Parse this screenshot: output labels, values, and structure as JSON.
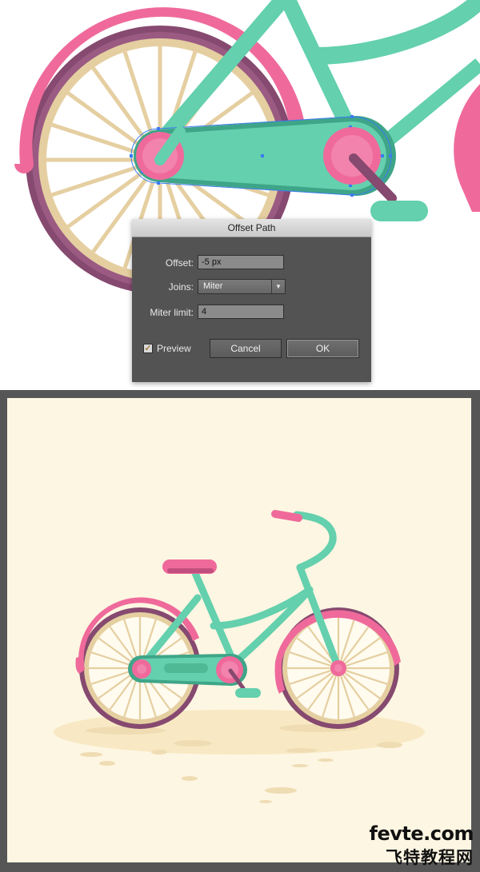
{
  "dialog": {
    "title": "Offset Path",
    "offset_label": "Offset:",
    "offset_value": "-5 px",
    "joins_label": "Joins:",
    "joins_value": "Miter",
    "miter_limit_label": "Miter limit:",
    "miter_limit_value": "4",
    "preview_label": "Preview",
    "preview_checked": true,
    "cancel_label": "Cancel",
    "ok_label": "OK"
  },
  "watermark": {
    "line1": "fevte.com",
    "line2": "飞特教程网"
  },
  "colors": {
    "mint": "#64d0ad",
    "mint_dark": "#3fa588",
    "pink": "#ef6a9b",
    "pink_dark": "#c14f7e",
    "tire": "#86496f",
    "rim": "#e5cfa1",
    "background": "#fdf6e2",
    "selection_blue": "#3b7bf2",
    "dialog_bg": "#535353",
    "frame": "#565656"
  },
  "icons": {
    "select_caret": "chevron-down-icon",
    "preview_check": "checkmark-icon"
  }
}
